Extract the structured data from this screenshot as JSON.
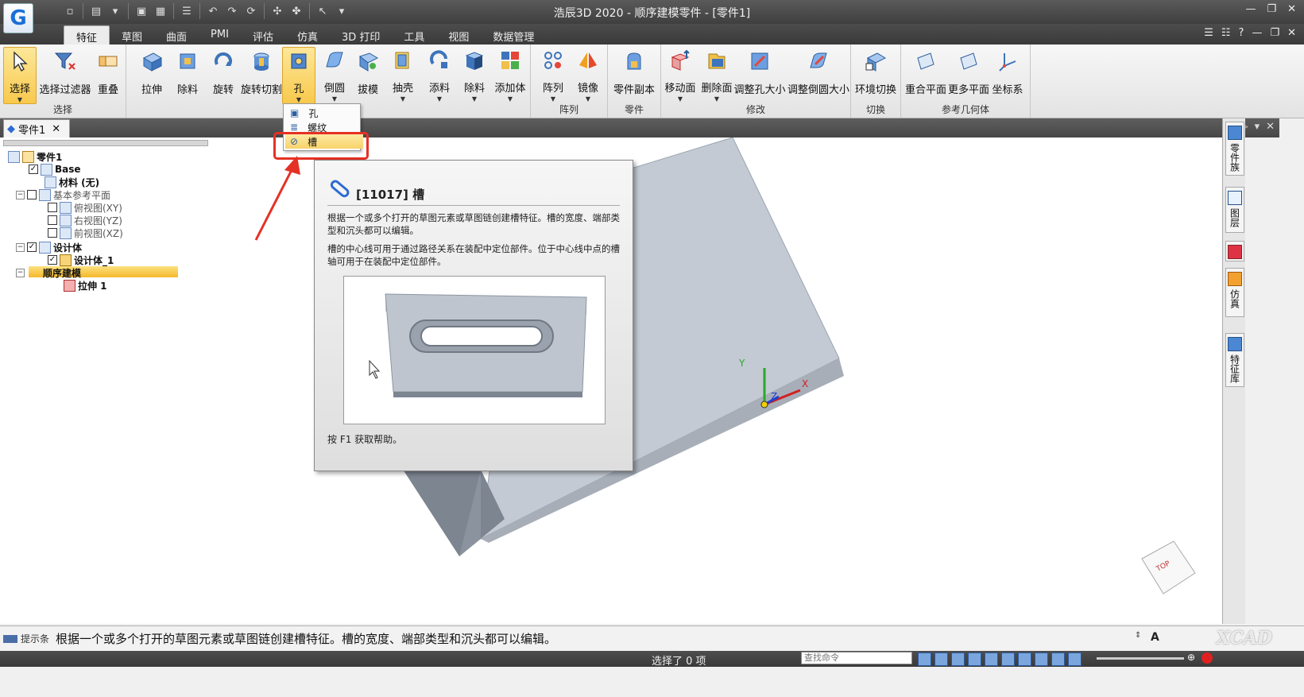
{
  "window": {
    "title": "浩辰3D 2020 - 顺序建模零件 - [零件1]",
    "logo_letter": "G"
  },
  "tabs": [
    "特征",
    "草图",
    "曲面",
    "PMI",
    "评估",
    "仿真",
    "3D 打印",
    "工具",
    "视图",
    "数据管理"
  ],
  "active_tab": "特征",
  "ribbon": {
    "select": {
      "btn_select": "选择",
      "btn_filter": "选择过滤器",
      "btn_overlap": "重叠",
      "label": "选择"
    },
    "solid": [
      "拉伸",
      "除料",
      "旋转",
      "旋转切割",
      "孔",
      "倒圆",
      "拔模",
      "抽壳",
      "添料",
      "除料",
      "添加体"
    ],
    "pattern": {
      "btn_array": "阵列",
      "btn_mirror": "镜像",
      "label": "阵列"
    },
    "part": {
      "btn_copy": "零件副本",
      "label": "零件"
    },
    "modify": {
      "btns": [
        "移动面",
        "删除面",
        "调整孔大小",
        "调整倒圆大小"
      ],
      "label": "修改"
    },
    "switch": {
      "btn": "环境切换",
      "label": "切换"
    },
    "refgeom": {
      "btns": [
        "重合平面",
        "更多平面",
        "坐标系"
      ],
      "label": "参考几何体"
    }
  },
  "doc_tab": {
    "label": "零件1"
  },
  "tree": {
    "root": "零件1",
    "base": "Base",
    "material": "材料 (无)",
    "ref_planes": "基本参考平面",
    "plane_top": "俯视图(XY)",
    "plane_right": "右视图(YZ)",
    "plane_front": "前视图(XZ)",
    "design_body": "设计体",
    "design_body_1": "设计体_1",
    "seq_model": "顺序建模",
    "extrude_1": "拉伸 1"
  },
  "hole_menu": [
    "孔",
    "螺纹",
    "槽"
  ],
  "tooltip": {
    "title": "[11017] 槽",
    "para1": "根据一个或多个打开的草图元素或草图链创建槽特征。槽的宽度、端部类型和沉头都可以编辑。",
    "para2": "槽的中心线可用于通过路径关系在装配中定位部件。位于中心线中点的槽轴可用于在装配中定位部件。",
    "help": "按 F1 获取帮助。"
  },
  "dock_tabs": [
    "零件族",
    "图层",
    "仿真",
    "特征库"
  ],
  "axes": {
    "x": "X",
    "y": "Y",
    "z": "Z"
  },
  "view_cube_face": "TOP",
  "prompt": {
    "label": "提示条",
    "text": "根据一个或多个打开的草图元素或草图链创建槽特征。槽的宽度、端部类型和沉头都可以编辑。"
  },
  "status": {
    "selection": "选择了 0 项",
    "search_placeholder": "查找命令"
  },
  "watermark": "XCAD",
  "colors": {
    "accent_orange": "#f8c94c",
    "highlight_red": "#e53125",
    "model_gray": "#c3cad3"
  }
}
